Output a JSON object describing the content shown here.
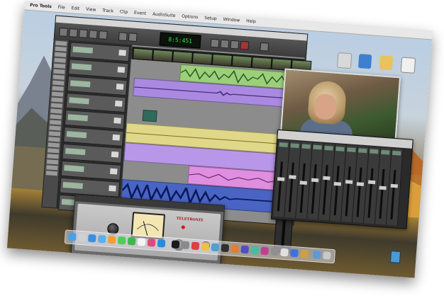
{
  "menubar": {
    "app": "Pro Tools",
    "items": [
      "File",
      "Edit",
      "View",
      "Track",
      "Clip",
      "Event",
      "AudioSuite",
      "Options",
      "Setup",
      "Window",
      "Help"
    ],
    "clock": ""
  },
  "edit_window": {
    "main_counter": "8:5:451"
  },
  "plugin": {
    "brand": "TELETRONIX"
  },
  "colors": {
    "clip_green": "#9ccf7a",
    "clip_purple": "#a98ae0",
    "clip_yellow": "#e0d889",
    "clip_pink": "#e08ee0",
    "clip_blue": "#4a64c4",
    "counter_green": "#39e34a"
  }
}
